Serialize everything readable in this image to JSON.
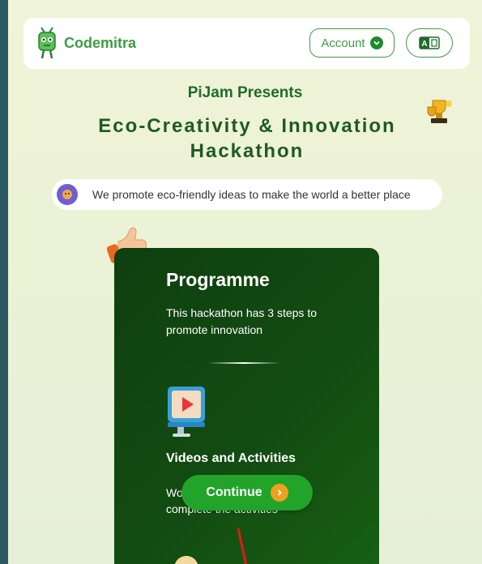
{
  "header": {
    "brand": "Codemitra",
    "account_label": "Account",
    "language_icon": "translate-icon"
  },
  "hero": {
    "presents": "PiJam Presents",
    "title": "Eco-Creativity & Innovation Hackathon",
    "tagline": "We promote eco-friendly ideas to make the world a better place"
  },
  "programme": {
    "title": "Programme",
    "description": "This hackathon has 3 steps to promote innovation",
    "steps": [
      {
        "title": "Videos and Activities",
        "description_visible": "Wo",
        "description_visible_2": "complete the activities"
      }
    ]
  },
  "actions": {
    "continue_label": "Continue"
  },
  "colors": {
    "brand_green": "#3e9c45",
    "card_green": "#134d12",
    "button_green": "#22a32a",
    "accent_orange": "#f0a020"
  }
}
